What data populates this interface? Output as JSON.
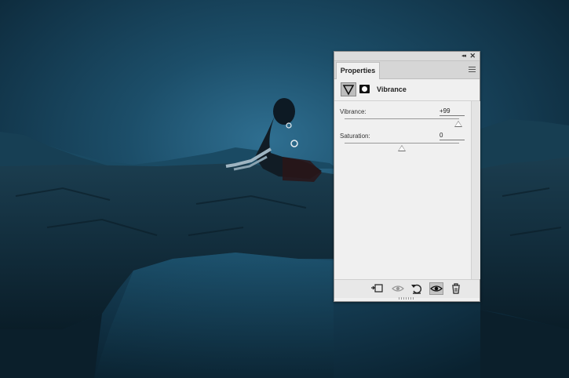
{
  "panel": {
    "collapse_glyph": "◂◂",
    "close_glyph": "✕",
    "tab_label": "Properties",
    "menu_icon": "panel-menu-icon",
    "adjustment_icon": "vibrance-icon",
    "mask_icon": "layer-mask-icon",
    "title": "Vibrance",
    "fields": [
      {
        "label": "Vibrance:",
        "value": "+99",
        "slider_level": 0.995
      },
      {
        "label": "Saturation:",
        "value": "0",
        "slider_level": 0.5
      }
    ],
    "footer_icons": [
      "clip-to-layer-icon",
      "view-previous-state-icon",
      "reset-icon",
      "toggle-visibility-icon",
      "delete-icon"
    ]
  },
  "colors": {
    "panel_bg": "#f0f0f0",
    "scene_sky": "#12374b",
    "scene_rock": "#0c2230"
  }
}
